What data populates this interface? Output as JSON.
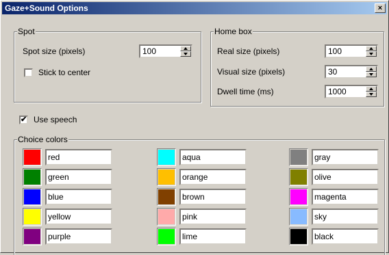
{
  "window": {
    "title": "Gaze+Sound Options",
    "close_glyph": "×"
  },
  "spot": {
    "legend": "Spot",
    "size_label": "Spot size (pixels)",
    "size_value": "100",
    "stick_label": "Stick to center",
    "stick_checked": false
  },
  "homebox": {
    "legend": "Home box",
    "real_label": "Real size (pixels)",
    "real_value": "100",
    "visual_label": "Visual size (pixels)",
    "visual_value": "30",
    "dwell_label": "Dwell time (ms)",
    "dwell_value": "1000"
  },
  "speech": {
    "label": "Use speech",
    "checked": true,
    "check_glyph": "✔"
  },
  "colors": {
    "legend": "Choice colors",
    "items": [
      {
        "name": "red",
        "hex": "#ff0000"
      },
      {
        "name": "green",
        "hex": "#008000"
      },
      {
        "name": "blue",
        "hex": "#0000ff"
      },
      {
        "name": "yellow",
        "hex": "#ffff00"
      },
      {
        "name": "purple",
        "hex": "#800080"
      },
      {
        "name": "aqua",
        "hex": "#00ffff"
      },
      {
        "name": "orange",
        "hex": "#ffbf00"
      },
      {
        "name": "brown",
        "hex": "#804000"
      },
      {
        "name": "pink",
        "hex": "#ffaaaa"
      },
      {
        "name": "lime",
        "hex": "#00ff00"
      },
      {
        "name": "gray",
        "hex": "#808080"
      },
      {
        "name": "olive",
        "hex": "#808000"
      },
      {
        "name": "magenta",
        "hex": "#ff00ff"
      },
      {
        "name": "sky",
        "hex": "#88bbff"
      },
      {
        "name": "black",
        "hex": "#000000"
      }
    ]
  }
}
